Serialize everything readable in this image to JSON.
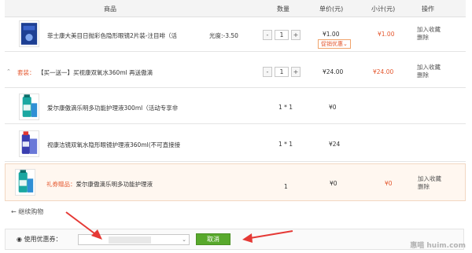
{
  "header": {
    "col_product": "商品",
    "col_qty": "数量",
    "col_price": "单价(元)",
    "col_subtotal": "小计(元)",
    "col_ops": "操作"
  },
  "rows": [
    {
      "name": "菲士康大美目日抛彩色隐形眼镜2片装-注目啡（活",
      "spec": "光度:-3.50",
      "qty": "1",
      "minus": "-",
      "plus": "+",
      "price": "¥1.00",
      "promo": "促销优惠⌄",
      "subtotal": "¥1.00",
      "op1": "加入收藏",
      "op2": "删除"
    }
  ],
  "bundle": {
    "caret": "⌃",
    "label": "套装：",
    "name": "【买一送一】买视康双氧水360ml 再送傲滴",
    "qty": "1",
    "minus": "-",
    "plus": "+",
    "price": "¥24.00",
    "subtotal": "¥24.00",
    "op1": "加入收藏",
    "op2": "删除",
    "items": [
      {
        "name": "爱尔康傲滴乐明多功能护理液300ml（活动专享非",
        "qty": "1 * 1",
        "price": "¥0"
      },
      {
        "name": "视康洁镜双氧水隐形眼镜护理液360ml(不可直接接",
        "qty": "1 * 1",
        "price": "¥24"
      }
    ]
  },
  "gift": {
    "tag": "礼券赠品：",
    "name": "爱尔康傲滴乐明多功能护理液",
    "qty": "1",
    "price": "¥0",
    "subtotal": "¥0",
    "op1": "加入收藏",
    "op2": "删除"
  },
  "continue_shopping": "← 继续购物",
  "coupon": {
    "label": "◉ 使用优惠券：",
    "select_arrow": "⌄",
    "cancel": "取消"
  },
  "watermark": "惠喵 huim.com",
  "colors": {
    "accent": "#e4572e",
    "button_green": "#58a92c",
    "annotation_arrow": "#e53935"
  }
}
